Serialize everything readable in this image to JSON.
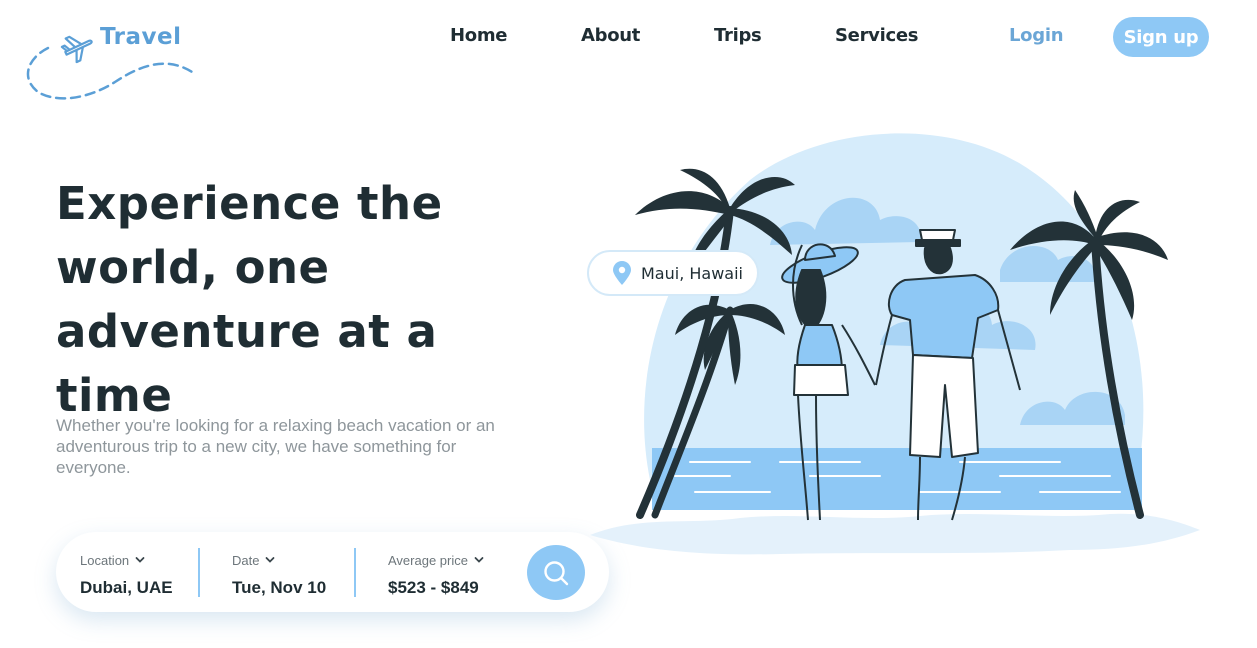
{
  "logo": {
    "brand": "Travel"
  },
  "nav": {
    "items": [
      {
        "label": "Home"
      },
      {
        "label": "About"
      },
      {
        "label": "Trips"
      },
      {
        "label": "Services"
      }
    ],
    "login_label": "Login",
    "signup_label": "Sign up"
  },
  "hero": {
    "title_lines": [
      "Experience the",
      "world, one",
      "adventure at a time"
    ],
    "subtitle": "Whether you're looking for a relaxing beach vacation or an adventurous trip to a new city, we have something for everyone."
  },
  "search": {
    "location": {
      "label": "Location",
      "value": "Dubai, UAE"
    },
    "date": {
      "label": "Date",
      "value": "Tue, Nov 10"
    },
    "price": {
      "label": "Average price",
      "value": "$523 - $849"
    },
    "button_icon": "search-icon"
  },
  "badge": {
    "label": "Maui, Hawaii",
    "icon": "location-pin-icon"
  },
  "colors": {
    "accent": "#8ec8f5",
    "brand": "#5b9fd6",
    "text": "#1f2d33",
    "muted": "#8e969b"
  }
}
